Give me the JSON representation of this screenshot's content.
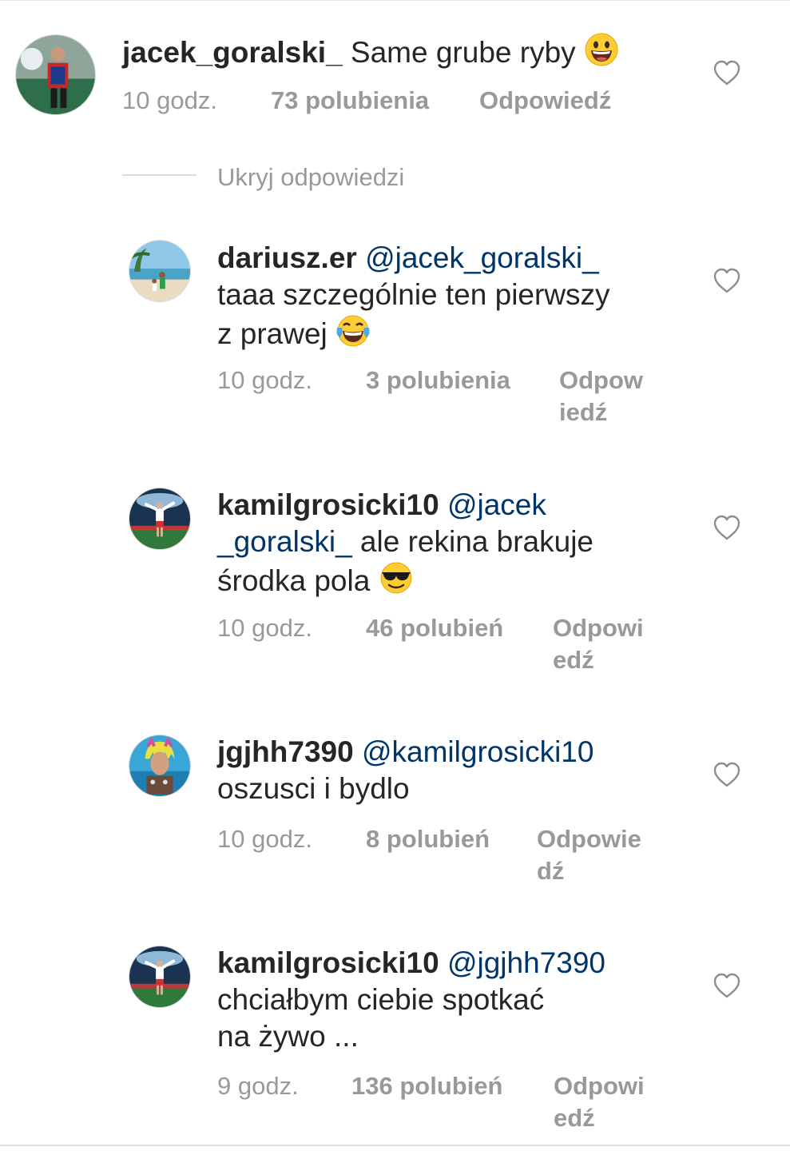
{
  "comments": [
    {
      "username": "jacek_goralski_",
      "mention": "",
      "text": "Same grube ryby",
      "emoji": "grinning-face",
      "time": "10 godz.",
      "likes": "73 polubienia",
      "reply": "Odpowiedź"
    },
    {
      "username": "dariusz.er",
      "mention": "@jacek_goralski_",
      "text_line2": "taaa szczególnie ten pierwszy",
      "text_line3": "z prawej",
      "emoji": "tears-of-joy-face",
      "time": "10 godz.",
      "likes": "3 polubienia",
      "reply_line1": "Odpow",
      "reply_line2": "iedź"
    },
    {
      "username": "kamilgrosicki10",
      "mention_part1": "@jacek",
      "mention_part2": "_goralski_",
      "text_line2": " ale rekina brakuje",
      "text_line3": "środka pola",
      "emoji": "sunglasses-face",
      "time": "10 godz.",
      "likes": "46 polubień",
      "reply_line1": "Odpowi",
      "reply_line2": "edź"
    },
    {
      "username": "jgjhh7390",
      "mention": "@kamilgrosicki10",
      "text_line2": "oszusci i bydlo",
      "time": "10 godz.",
      "likes": "8 polubień",
      "reply_line1": "Odpowie",
      "reply_line2": "dź"
    },
    {
      "username": "kamilgrosicki10",
      "mention": "@jgjhh7390",
      "text_line2": "chciałbym ciebie spotkać",
      "text_line3": "na żywo ...",
      "time": "9 godz.",
      "likes": "136 polubień",
      "reply_line1": "Odpowi",
      "reply_line2": "edź"
    }
  ],
  "hide_replies": "Ukryj odpowiedzi",
  "icons": {
    "like": "heart-outline-icon"
  },
  "colors": {
    "text": "#262626",
    "mention": "#003569",
    "secondary": "#999999"
  }
}
